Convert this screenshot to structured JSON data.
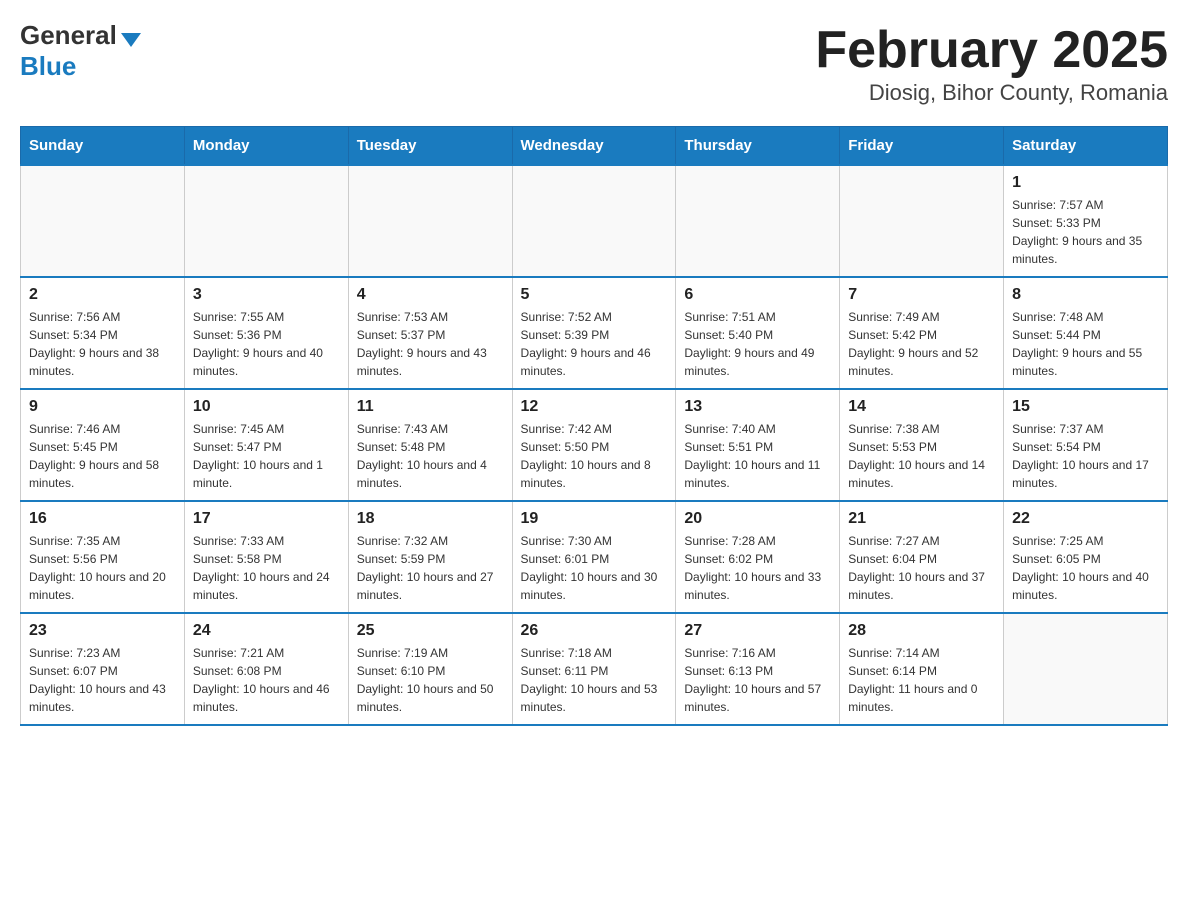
{
  "logo": {
    "general": "General",
    "blue": "Blue",
    "triangle": "▼"
  },
  "title": "February 2025",
  "subtitle": "Diosig, Bihor County, Romania",
  "weekdays": [
    "Sunday",
    "Monday",
    "Tuesday",
    "Wednesday",
    "Thursday",
    "Friday",
    "Saturday"
  ],
  "weeks": [
    [
      {
        "day": "",
        "info": ""
      },
      {
        "day": "",
        "info": ""
      },
      {
        "day": "",
        "info": ""
      },
      {
        "day": "",
        "info": ""
      },
      {
        "day": "",
        "info": ""
      },
      {
        "day": "",
        "info": ""
      },
      {
        "day": "1",
        "info": "Sunrise: 7:57 AM\nSunset: 5:33 PM\nDaylight: 9 hours and 35 minutes."
      }
    ],
    [
      {
        "day": "2",
        "info": "Sunrise: 7:56 AM\nSunset: 5:34 PM\nDaylight: 9 hours and 38 minutes."
      },
      {
        "day": "3",
        "info": "Sunrise: 7:55 AM\nSunset: 5:36 PM\nDaylight: 9 hours and 40 minutes."
      },
      {
        "day": "4",
        "info": "Sunrise: 7:53 AM\nSunset: 5:37 PM\nDaylight: 9 hours and 43 minutes."
      },
      {
        "day": "5",
        "info": "Sunrise: 7:52 AM\nSunset: 5:39 PM\nDaylight: 9 hours and 46 minutes."
      },
      {
        "day": "6",
        "info": "Sunrise: 7:51 AM\nSunset: 5:40 PM\nDaylight: 9 hours and 49 minutes."
      },
      {
        "day": "7",
        "info": "Sunrise: 7:49 AM\nSunset: 5:42 PM\nDaylight: 9 hours and 52 minutes."
      },
      {
        "day": "8",
        "info": "Sunrise: 7:48 AM\nSunset: 5:44 PM\nDaylight: 9 hours and 55 minutes."
      }
    ],
    [
      {
        "day": "9",
        "info": "Sunrise: 7:46 AM\nSunset: 5:45 PM\nDaylight: 9 hours and 58 minutes."
      },
      {
        "day": "10",
        "info": "Sunrise: 7:45 AM\nSunset: 5:47 PM\nDaylight: 10 hours and 1 minute."
      },
      {
        "day": "11",
        "info": "Sunrise: 7:43 AM\nSunset: 5:48 PM\nDaylight: 10 hours and 4 minutes."
      },
      {
        "day": "12",
        "info": "Sunrise: 7:42 AM\nSunset: 5:50 PM\nDaylight: 10 hours and 8 minutes."
      },
      {
        "day": "13",
        "info": "Sunrise: 7:40 AM\nSunset: 5:51 PM\nDaylight: 10 hours and 11 minutes."
      },
      {
        "day": "14",
        "info": "Sunrise: 7:38 AM\nSunset: 5:53 PM\nDaylight: 10 hours and 14 minutes."
      },
      {
        "day": "15",
        "info": "Sunrise: 7:37 AM\nSunset: 5:54 PM\nDaylight: 10 hours and 17 minutes."
      }
    ],
    [
      {
        "day": "16",
        "info": "Sunrise: 7:35 AM\nSunset: 5:56 PM\nDaylight: 10 hours and 20 minutes."
      },
      {
        "day": "17",
        "info": "Sunrise: 7:33 AM\nSunset: 5:58 PM\nDaylight: 10 hours and 24 minutes."
      },
      {
        "day": "18",
        "info": "Sunrise: 7:32 AM\nSunset: 5:59 PM\nDaylight: 10 hours and 27 minutes."
      },
      {
        "day": "19",
        "info": "Sunrise: 7:30 AM\nSunset: 6:01 PM\nDaylight: 10 hours and 30 minutes."
      },
      {
        "day": "20",
        "info": "Sunrise: 7:28 AM\nSunset: 6:02 PM\nDaylight: 10 hours and 33 minutes."
      },
      {
        "day": "21",
        "info": "Sunrise: 7:27 AM\nSunset: 6:04 PM\nDaylight: 10 hours and 37 minutes."
      },
      {
        "day": "22",
        "info": "Sunrise: 7:25 AM\nSunset: 6:05 PM\nDaylight: 10 hours and 40 minutes."
      }
    ],
    [
      {
        "day": "23",
        "info": "Sunrise: 7:23 AM\nSunset: 6:07 PM\nDaylight: 10 hours and 43 minutes."
      },
      {
        "day": "24",
        "info": "Sunrise: 7:21 AM\nSunset: 6:08 PM\nDaylight: 10 hours and 46 minutes."
      },
      {
        "day": "25",
        "info": "Sunrise: 7:19 AM\nSunset: 6:10 PM\nDaylight: 10 hours and 50 minutes."
      },
      {
        "day": "26",
        "info": "Sunrise: 7:18 AM\nSunset: 6:11 PM\nDaylight: 10 hours and 53 minutes."
      },
      {
        "day": "27",
        "info": "Sunrise: 7:16 AM\nSunset: 6:13 PM\nDaylight: 10 hours and 57 minutes."
      },
      {
        "day": "28",
        "info": "Sunrise: 7:14 AM\nSunset: 6:14 PM\nDaylight: 11 hours and 0 minutes."
      },
      {
        "day": "",
        "info": ""
      }
    ]
  ]
}
